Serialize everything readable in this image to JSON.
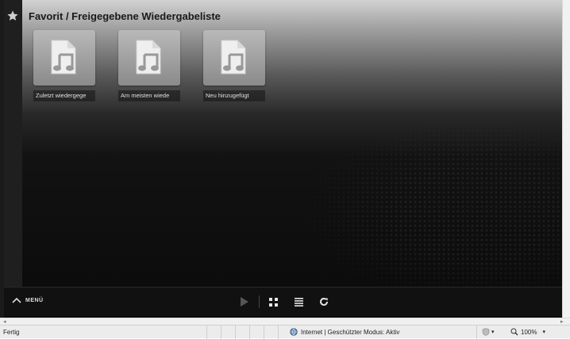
{
  "page": {
    "title": "Favorit / Freigegebene Wiedergabeliste"
  },
  "tiles": [
    {
      "label": "Zuletzt wiedergege",
      "icon": "music-file-icon"
    },
    {
      "label": "Am meisten wiede",
      "icon": "music-file-icon"
    },
    {
      "label": "Neu hinzugefügt",
      "icon": "music-file-icon"
    }
  ],
  "toolbar": {
    "menu_label": "MENÜ",
    "icons": [
      "play-icon",
      "grid-view-icon",
      "list-view-icon",
      "refresh-icon"
    ]
  },
  "status": {
    "left_text": "Fertig",
    "zone_text": "Internet | Geschützter Modus: Aktiv",
    "zoom_text": "100%"
  },
  "colors": {
    "app_background": "#0d0d0d",
    "header_gradient_top": "#d2d2d2",
    "tile": "#9a9a9a"
  }
}
